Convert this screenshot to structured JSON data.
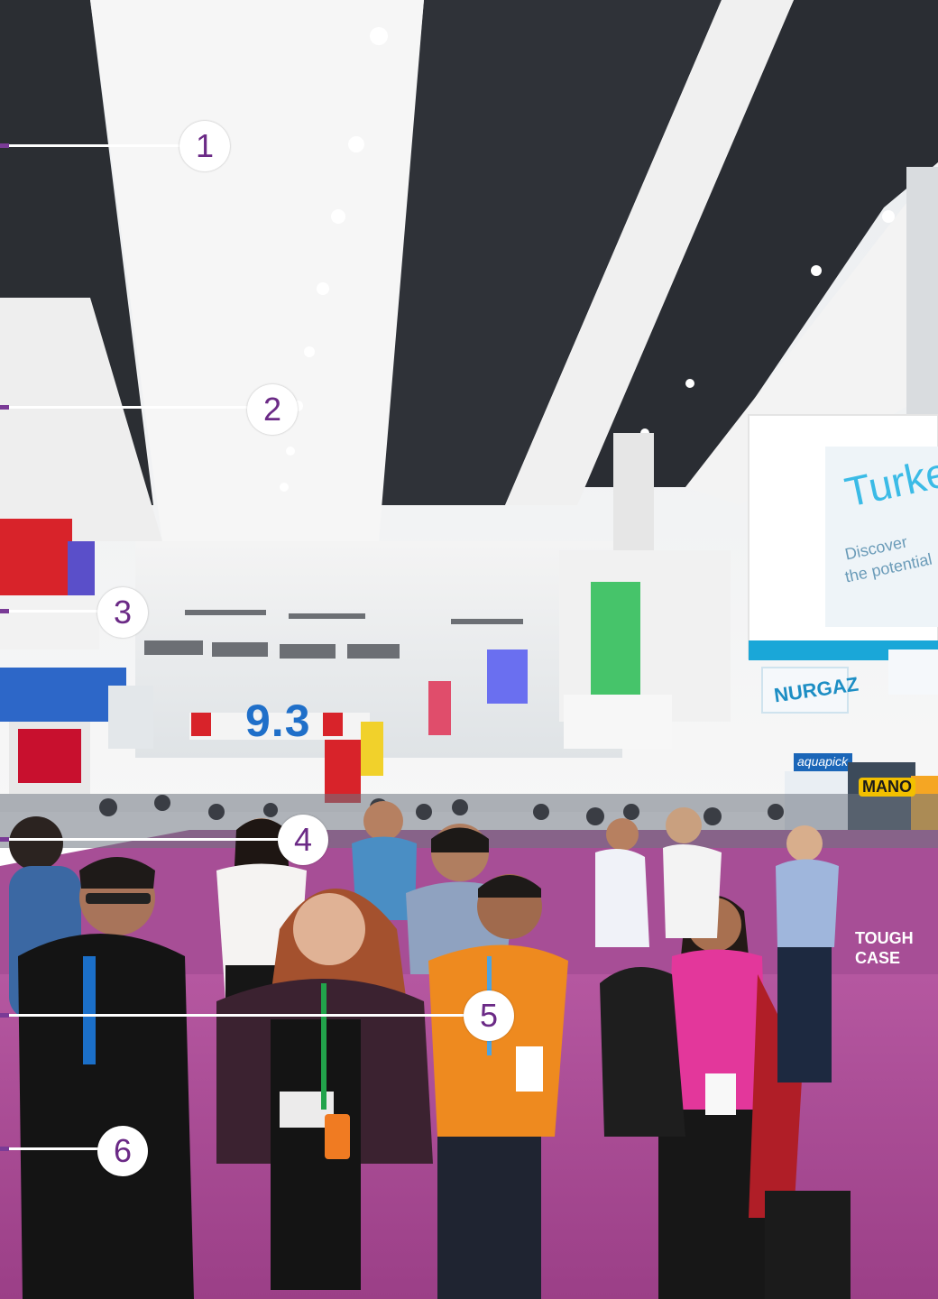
{
  "scene": {
    "description_icon": "exhibition-hall-photo",
    "carpet_color": "#a3478f",
    "ceiling_color": "#f2f2f2"
  },
  "signs": {
    "hall_number": "9.3",
    "turkey": "Turkey",
    "turkey_sub1": "Discover",
    "turkey_sub2": "the potential",
    "nurgaz": "NURGAZ",
    "aquapick": "aquapick",
    "mano": "MANO",
    "tough_case_1": "TOUGH",
    "tough_case_2": "CASE"
  },
  "markers": [
    {
      "label": "1"
    },
    {
      "label": "2"
    },
    {
      "label": "3"
    },
    {
      "label": "4"
    },
    {
      "label": "5"
    },
    {
      "label": "6"
    }
  ],
  "colors": {
    "marker_text": "#6b2a86",
    "leader_tip": "#7a3b96"
  }
}
